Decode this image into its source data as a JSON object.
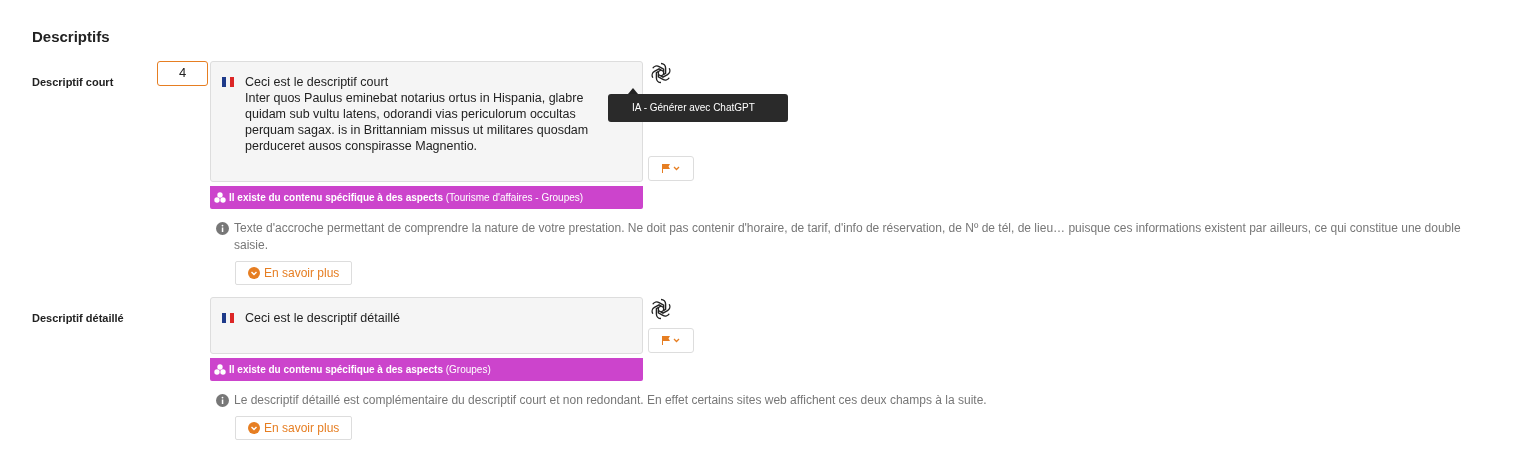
{
  "section_title": "Descriptifs",
  "fields": [
    {
      "label": "Descriptif court",
      "counter": "4",
      "lines": [
        "Ceci est le descriptif court",
        "Inter quos Paulus eminebat notarius ortus in Hispania, glabre",
        "quidam sub vultu latens, odorandi vias periculorum occultas",
        "perquam sagax. is in Brittanniam missus ut militares quosdam",
        "perduceret ausos conspirasse Magnentio."
      ],
      "tooltip": "IA - Générer avec ChatGPT",
      "aspects_label": "Il existe du contenu spécifique à des aspects",
      "aspects_detail": "(Tourisme d'affaires - Groupes)",
      "help": "Texte d'accroche permettant de comprendre la nature de votre prestation. Ne doit pas contenir d'horaire, de tarif, d'info de réservation, de Nº de tél, de lieu… puisque ces informations existent par ailleurs, ce qui constitue une double saisie.",
      "more": "En savoir plus"
    },
    {
      "label": "Descriptif détaillé",
      "lines": [
        "Ceci est le descriptif détaillé"
      ],
      "aspects_label": "Il existe du contenu spécifique à des aspects",
      "aspects_detail": "(Groupes)",
      "help": "Le descriptif détaillé est complémentaire du descriptif court et non redondant. En effet certains sites web affichent ces deux champs à la suite.",
      "more": "En savoir plus"
    }
  ]
}
